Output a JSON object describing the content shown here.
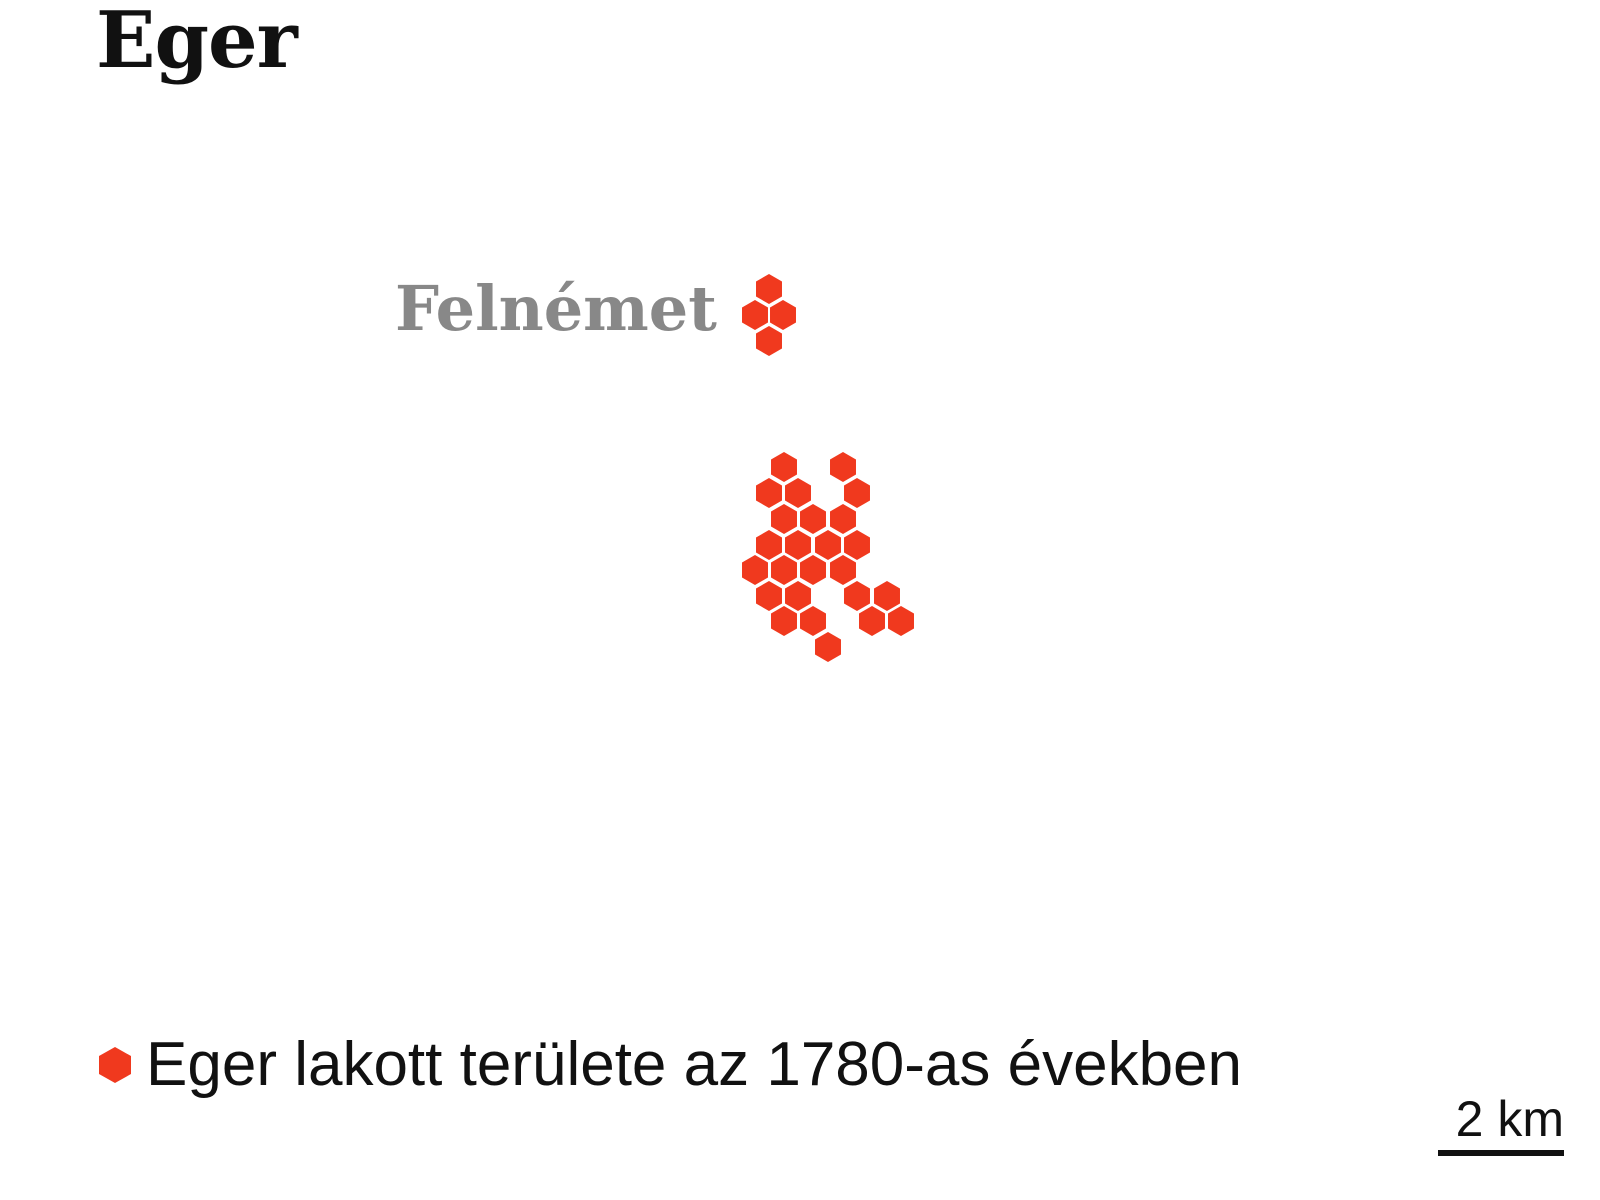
{
  "title": "Eger",
  "place_label": "Felnémet",
  "legend": {
    "label": "Eger lakott területe az 1780-as években",
    "color": "#f0391e",
    "icon": "hexagon-icon"
  },
  "scale": {
    "label": "2 km"
  },
  "colors": {
    "settlement": "#f0391e",
    "place_label": "#888888",
    "text": "#111111"
  }
}
